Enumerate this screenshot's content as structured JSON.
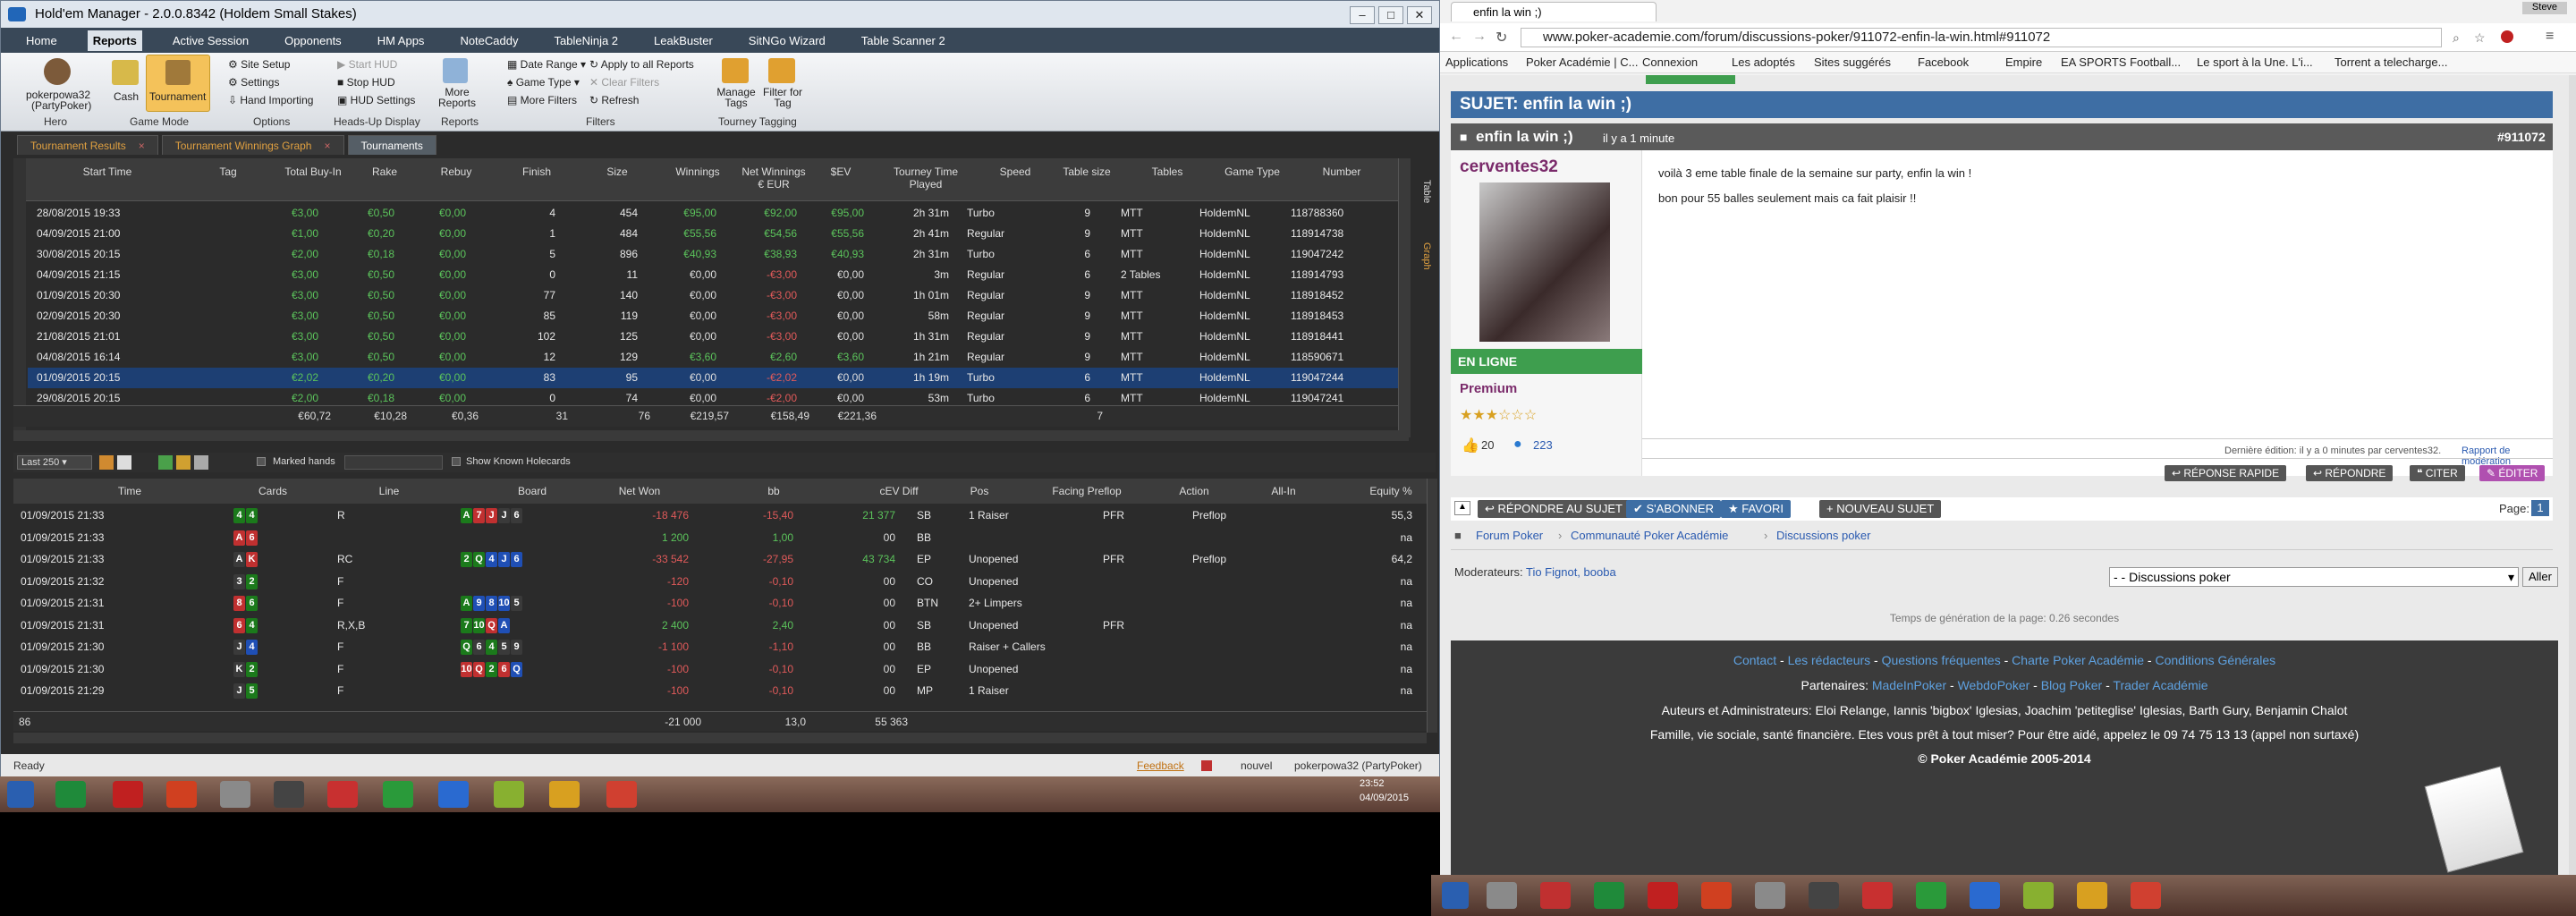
{
  "hem": {
    "title": "Hold'em Manager - 2.0.0.8342 (Holdem Small Stakes)",
    "menu": [
      "Home",
      "Reports",
      "Active Session",
      "Opponents",
      "HM Apps",
      "NoteCaddy",
      "TableNinja 2",
      "LeakBuster",
      "SitNGo Wizard",
      "Table Scanner 2"
    ],
    "ribbon": {
      "hero_name": "pokerpowa32",
      "hero_site": "(PartyPoker)",
      "hero_label": "Hero",
      "cash": "Cash",
      "tournament": "Tournament",
      "game_mode": "Game Mode",
      "site_setup": "Site Setup",
      "settings": "Settings",
      "hand_importing": "Hand Importing",
      "options": "Options",
      "start_hud": "Start HUD",
      "stop_hud": "Stop HUD",
      "hud_settings": "HUD Settings",
      "hud_display": "Heads-Up Display",
      "more_reports": "More Reports",
      "reports": "Reports",
      "date_range": "Date Range",
      "game_type": "Game Type",
      "more_filters": "More Filters",
      "apply_all": "Apply to all Reports",
      "clear_filters": "Clear Filters",
      "refresh": "Refresh",
      "filters": "Filters",
      "manage_tags": "Manage Tags",
      "filter_tag": "Filter for Tag",
      "tourney_tagging": "Tourney Tagging"
    },
    "tabs": [
      "Tournament Results",
      "Tournament Winnings Graph",
      "Tournaments"
    ],
    "side_tabs": [
      "Table",
      "Graph"
    ],
    "tourney_headers": [
      "Start Time",
      "Tag",
      "Total Buy-In",
      "Rake",
      "Rebuy",
      "Finish",
      "Size",
      "Winnings",
      "Net Winnings € EUR",
      "$EV",
      "Tourney Time Played",
      "Speed",
      "Table size",
      "Tables",
      "Game Type",
      "Number"
    ],
    "tourneys": [
      [
        "28/08/2015 19:33",
        "",
        "€3,00",
        "€0,50",
        "€0,00",
        "4",
        "454",
        "€95,00",
        "€92,00",
        "€95,00",
        "2h 31m",
        "Turbo",
        "9",
        "MTT",
        "HoldemNL",
        "118788360"
      ],
      [
        "04/09/2015 21:00",
        "",
        "€1,00",
        "€0,20",
        "€0,00",
        "1",
        "484",
        "€55,56",
        "€54,56",
        "€55,56",
        "2h 41m",
        "Regular",
        "9",
        "MTT",
        "HoldemNL",
        "118914738"
      ],
      [
        "30/08/2015 20:15",
        "",
        "€2,00",
        "€0,18",
        "€0,00",
        "5",
        "896",
        "€40,93",
        "€38,93",
        "€40,93",
        "2h 31m",
        "Turbo",
        "6",
        "MTT",
        "HoldemNL",
        "119047242"
      ],
      [
        "04/09/2015 21:15",
        "",
        "€3,00",
        "€0,50",
        "€0,00",
        "0",
        "11",
        "€0,00",
        "-€3,00",
        "€0,00",
        "3m",
        "Regular",
        "6",
        "2 Tables",
        "HoldemNL",
        "118914793"
      ],
      [
        "01/09/2015 20:30",
        "",
        "€3,00",
        "€0,50",
        "€0,00",
        "77",
        "140",
        "€0,00",
        "-€3,00",
        "€0,00",
        "1h 01m",
        "Regular",
        "9",
        "MTT",
        "HoldemNL",
        "118918452"
      ],
      [
        "02/09/2015 20:30",
        "",
        "€3,00",
        "€0,50",
        "€0,00",
        "85",
        "119",
        "€0,00",
        "-€3,00",
        "€0,00",
        "58m",
        "Regular",
        "9",
        "MTT",
        "HoldemNL",
        "118918453"
      ],
      [
        "21/08/2015 21:01",
        "",
        "€3,00",
        "€0,50",
        "€0,00",
        "102",
        "125",
        "€0,00",
        "-€3,00",
        "€0,00",
        "1h 31m",
        "Regular",
        "9",
        "MTT",
        "HoldemNL",
        "118918441"
      ],
      [
        "04/08/2015 16:14",
        "",
        "€3,00",
        "€0,50",
        "€0,00",
        "12",
        "129",
        "€3,60",
        "€2,60",
        "€3,60",
        "1h 21m",
        "Regular",
        "9",
        "MTT",
        "HoldemNL",
        "118590671"
      ],
      [
        "01/09/2015 20:15",
        "",
        "€2,02",
        "€0,20",
        "€0,00",
        "83",
        "95",
        "€0,00",
        "-€2,02",
        "€0,00",
        "1h 19m",
        "Turbo",
        "6",
        "MTT",
        "HoldemNL",
        "119047244"
      ],
      [
        "29/08/2015 20:15",
        "",
        "€2,00",
        "€0,18",
        "€0,00",
        "0",
        "74",
        "€0,00",
        "-€2,00",
        "€0,00",
        "53m",
        "Turbo",
        "6",
        "MTT",
        "HoldemNL",
        "119047241"
      ]
    ],
    "tourney_totals": [
      "€60,72",
      "€10,28",
      "€0,36",
      "31",
      "76",
      "€219,57",
      "€158,49",
      "€221,36",
      "",
      "",
      "7"
    ],
    "hand_toolbar": {
      "last": "Last 250",
      "marked": "Marked hands",
      "known": "Show Known Holecards"
    },
    "hand_headers": [
      "Time",
      "Cards",
      "Line",
      "Board",
      "Net Won",
      "bb",
      "cEV Diff",
      "Pos",
      "Facing Preflop",
      "Action",
      "All-In",
      "Equity %"
    ],
    "hands": [
      {
        "time": "01/09/2015 21:33",
        "cards": [
          [
            "4",
            "s"
          ],
          [
            "4",
            "s"
          ]
        ],
        "line": "R",
        "board": [
          [
            "A",
            "s"
          ],
          [
            "7",
            "h"
          ],
          [
            "J",
            "h"
          ],
          [
            "J",
            "c"
          ],
          [
            "6",
            "c"
          ]
        ],
        "net": "-18 476",
        "bb": "-15,40",
        "cev": "21 377",
        "pos": "SB",
        "facing": "1 Raiser",
        "action": "PFR",
        "allin": "Preflop",
        "eq": "55,3"
      },
      {
        "time": "01/09/2015 21:33",
        "cards": [
          [
            "A",
            "h"
          ],
          [
            "6",
            "h"
          ]
        ],
        "line": "",
        "board": [],
        "net": "1 200",
        "bb": "1,00",
        "cev": "00",
        "pos": "BB",
        "facing": "",
        "action": "",
        "allin": "",
        "eq": "na"
      },
      {
        "time": "01/09/2015 21:33",
        "cards": [
          [
            "A",
            "c"
          ],
          [
            "K",
            "h"
          ]
        ],
        "line": "RC",
        "board": [
          [
            "2",
            "s"
          ],
          [
            "Q",
            "s"
          ],
          [
            "4",
            "d"
          ],
          [
            "J",
            "d"
          ],
          [
            "6",
            "d"
          ]
        ],
        "net": "-33 542",
        "bb": "-27,95",
        "cev": "43 734",
        "pos": "EP",
        "facing": "Unopened",
        "action": "PFR",
        "allin": "Preflop",
        "eq": "64,2"
      },
      {
        "time": "01/09/2015 21:32",
        "cards": [
          [
            "3",
            "c"
          ],
          [
            "2",
            "s"
          ]
        ],
        "line": "F",
        "board": [],
        "net": "-120",
        "bb": "-0,10",
        "cev": "00",
        "pos": "CO",
        "facing": "Unopened",
        "action": "",
        "allin": "",
        "eq": "na"
      },
      {
        "time": "01/09/2015 21:31",
        "cards": [
          [
            "8",
            "h"
          ],
          [
            "6",
            "s"
          ]
        ],
        "line": "F",
        "board": [
          [
            "A",
            "s"
          ],
          [
            "9",
            "d"
          ],
          [
            "8",
            "d"
          ],
          [
            "10",
            "d"
          ],
          [
            "5",
            "c"
          ]
        ],
        "net": "-100",
        "bb": "-0,10",
        "cev": "00",
        "pos": "BTN",
        "facing": "2+ Limpers",
        "action": "",
        "allin": "",
        "eq": "na"
      },
      {
        "time": "01/09/2015 21:31",
        "cards": [
          [
            "6",
            "h"
          ],
          [
            "4",
            "s"
          ]
        ],
        "line": "R,X,B",
        "board": [
          [
            "7",
            "s"
          ],
          [
            "10",
            "s"
          ],
          [
            "Q",
            "h"
          ],
          [
            "A",
            "d"
          ]
        ],
        "net": "2 400",
        "bb": "2,40",
        "cev": "00",
        "pos": "SB",
        "facing": "Unopened",
        "action": "PFR",
        "allin": "",
        "eq": "na"
      },
      {
        "time": "01/09/2015 21:30",
        "cards": [
          [
            "J",
            "c"
          ],
          [
            "4",
            "d"
          ]
        ],
        "line": "F",
        "board": [
          [
            "Q",
            "s"
          ],
          [
            "6",
            "c"
          ],
          [
            "4",
            "s"
          ],
          [
            "5",
            "c"
          ],
          [
            "9",
            "c"
          ]
        ],
        "net": "-1 100",
        "bb": "-1,10",
        "cev": "00",
        "pos": "BB",
        "facing": "Raiser + Callers",
        "action": "",
        "allin": "",
        "eq": "na"
      },
      {
        "time": "01/09/2015 21:30",
        "cards": [
          [
            "K",
            "c"
          ],
          [
            "2",
            "s"
          ]
        ],
        "line": "F",
        "board": [
          [
            "10",
            "h"
          ],
          [
            "Q",
            "h"
          ],
          [
            "2",
            "s"
          ],
          [
            "6",
            "h"
          ],
          [
            "Q",
            "d"
          ]
        ],
        "net": "-100",
        "bb": "-0,10",
        "cev": "00",
        "pos": "EP",
        "facing": "Unopened",
        "action": "",
        "allin": "",
        "eq": "na"
      },
      {
        "time": "01/09/2015 21:29",
        "cards": [
          [
            "J",
            "c"
          ],
          [
            "5",
            "s"
          ]
        ],
        "line": "F",
        "board": [],
        "net": "-100",
        "bb": "-0,10",
        "cev": "00",
        "pos": "MP",
        "facing": "1 Raiser",
        "action": "",
        "allin": "",
        "eq": "na"
      }
    ],
    "hand_totals": {
      "count": "86",
      "net": "-21 000",
      "bb": "13,0",
      "cev": "55 363"
    },
    "status": {
      "ready": "Ready",
      "feedback": "Feedback",
      "notif": "nouvel",
      "hero": "pokerpowa32 (PartyPoker)"
    }
  },
  "browser": {
    "tab_title": "enfin la win ;)",
    "url": "www.poker-academie.com/forum/discussions-poker/911072-enfin-la-win.html#911072",
    "bookmarks": [
      "Applications",
      "Poker Académie | C...",
      "Connexion",
      "Les adoptés",
      "Sites suggérés",
      "Facebook",
      "Empire",
      "EA SPORTS Football...",
      "Le sport à la Une. L'i...",
      "Torrent a telecharge..."
    ],
    "user_badge": "Steve",
    "sujet": "SUJET: enfin la win ;)",
    "post_title": "enfin la win ;)",
    "post_time": "il y a 1 minute",
    "post_id": "#911072",
    "poster": "cerventes32",
    "online": "EN LIGNE",
    "rank": "Premium",
    "likes": "20",
    "comments": "223",
    "body1": "voilà 3 eme table finale de la semaine sur party, enfin la win !",
    "body2": "bon pour 55 balles seulement mais ca fait plaisir !!",
    "edited": "Dernière édition: il y a 0 minutes par cerventes32.",
    "report": "Rapport de modération",
    "btn_quick": "RÉPONSE RAPIDE",
    "btn_reply": "RÉPONDRE",
    "btn_quote": "CITER",
    "btn_edit": "ÉDITER",
    "btn_reply_topic": "RÉPONDRE AU SUJET",
    "btn_subscribe": "S'ABONNER",
    "btn_fav": "FAVORI",
    "btn_new": "NOUVEAU SUJET",
    "page_label": "Page:",
    "page_num": "1",
    "breadcrumb": [
      "Forum Poker",
      "Communauté Poker Académie",
      "Discussions poker"
    ],
    "moderators_label": "Moderateurs:",
    "moderators": "Tio Fignot, booba",
    "select_forum": "- - Discussions poker",
    "go_btn": "Aller",
    "gen_time": "Temps de génération de la page: 0.26 secondes",
    "footer_links": [
      "Contact",
      "Les rédacteurs",
      "Questions fréquentes",
      "Charte Poker Académie",
      "Conditions Générales"
    ],
    "partners_label": "Partenaires:",
    "partners": [
      "MadeInPoker",
      "WebdoPoker",
      "Blog Poker",
      "Trader Académie"
    ],
    "authors": "Auteurs et Administrateurs: Eloi Relange, Iannis 'bigbox' Iglesias, Joachim 'petiteglise' Iglesias, Barth Gury, Benjamin Chalot",
    "family": "Famille, vie sociale, santé financière. Etes vous prêt à tout miser? Pour être aidé, appelez le 09 74 75 13 13 (appel non surtaxé)",
    "copyright": "© Poker Académie 2005-2014"
  },
  "taskbar": {
    "time": "23:52",
    "date": "04/09/2015"
  },
  "colors": {
    "accent": "#3e6ea4",
    "pos": "#5bc35b",
    "neg": "#e05a5a",
    "sel": "#1d3f73"
  }
}
